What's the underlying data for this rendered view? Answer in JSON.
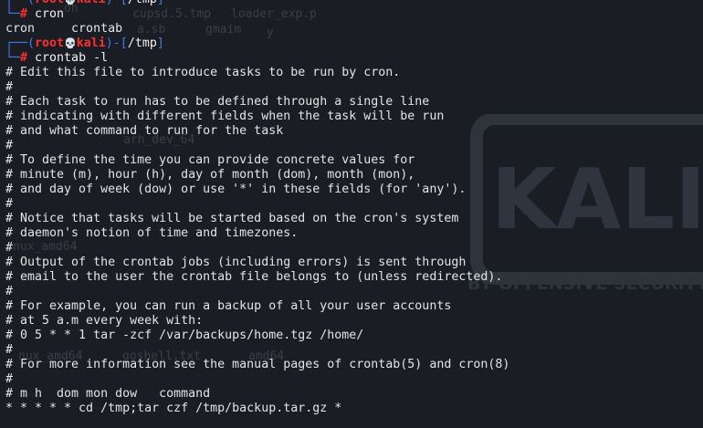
{
  "prompt": {
    "user": "root",
    "skull": "💀",
    "host": "kali",
    "path": "/tmp"
  },
  "background": {
    "watermark_ghost": [
      "oh",
      "cupsd.5.tmp",
      "loader_exp.p",
      "a.sb",
      "gmaim",
      "y",
      "arh_dev_64",
      "nux_amd64",
      "nux_amd64",
      "goshell.txt",
      "amd64"
    ],
    "logo_label": "KALI",
    "logo_tagline": "BY OFFENSIVE SECURITY"
  },
  "session": [
    {
      "type": "prompt",
      "command": "cron"
    },
    {
      "type": "output",
      "text": "cron     crontab"
    },
    {
      "type": "prompt",
      "command": "crontab -l"
    },
    {
      "type": "output",
      "text": "# Edit this file to introduce tasks to be run by cron."
    },
    {
      "type": "output",
      "text": "#"
    },
    {
      "type": "output",
      "text": "# Each task to run has to be defined through a single line"
    },
    {
      "type": "output",
      "text": "# indicating with different fields when the task will be run"
    },
    {
      "type": "output",
      "text": "# and what command to run for the task"
    },
    {
      "type": "output",
      "text": "#"
    },
    {
      "type": "output",
      "text": "# To define the time you can provide concrete values for"
    },
    {
      "type": "output",
      "text": "# minute (m), hour (h), day of month (dom), month (mon),"
    },
    {
      "type": "output",
      "text": "# and day of week (dow) or use '*' in these fields (for 'any')."
    },
    {
      "type": "output",
      "text": "#"
    },
    {
      "type": "output",
      "text": "# Notice that tasks will be started based on the cron's system"
    },
    {
      "type": "output",
      "text": "# daemon's notion of time and timezones."
    },
    {
      "type": "output",
      "text": "#"
    },
    {
      "type": "output",
      "text": "# Output of the crontab jobs (including errors) is sent through"
    },
    {
      "type": "output",
      "text": "# email to the user the crontab file belongs to (unless redirected)."
    },
    {
      "type": "output",
      "text": "#"
    },
    {
      "type": "output",
      "text": "# For example, you can run a backup of all your user accounts"
    },
    {
      "type": "output",
      "text": "# at 5 a.m every week with:"
    },
    {
      "type": "output",
      "text": "# 0 5 * * 1 tar -zcf /var/backups/home.tgz /home/"
    },
    {
      "type": "output",
      "text": "#"
    },
    {
      "type": "output",
      "text": "# For more information see the manual pages of crontab(5) and cron(8)"
    },
    {
      "type": "output",
      "text": "#"
    },
    {
      "type": "output",
      "text": "# m h  dom mon dow   command"
    },
    {
      "type": "output",
      "text": "* * * * * cd /tmp;tar czf /tmp/backup.tar.gz *"
    }
  ]
}
